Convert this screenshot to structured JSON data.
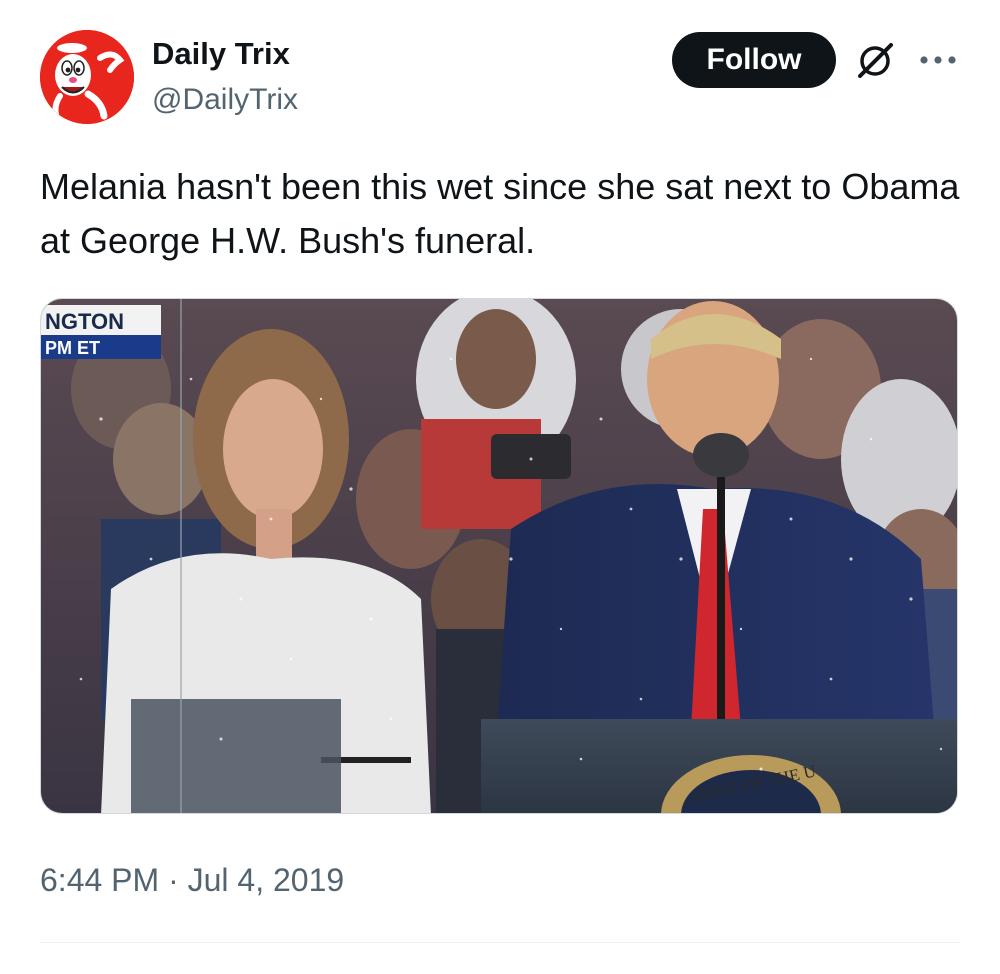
{
  "author": {
    "display_name": "Daily Trix",
    "handle": "@DailyTrix",
    "avatar_icon": "trix-rabbit-avatar"
  },
  "actions": {
    "follow_label": "Follow",
    "grok_icon": "grok-icon",
    "more_icon": "more-icon"
  },
  "tweet": {
    "text": "Melania hasn't been this wet since she sat next to Obama at George H.W. Bush's funeral.",
    "timestamp": "6:44 PM · Jul 4, 2019"
  },
  "media": {
    "chyron_top": "NGTON",
    "chyron_bottom": "PM ET",
    "seal_text": "DENT OF THE U"
  },
  "colors": {
    "text": "#0f1419",
    "secondary": "#536471",
    "follow_bg": "#0f1419",
    "avatar_bg": "#e8261d",
    "divider": "#eff3f4"
  }
}
